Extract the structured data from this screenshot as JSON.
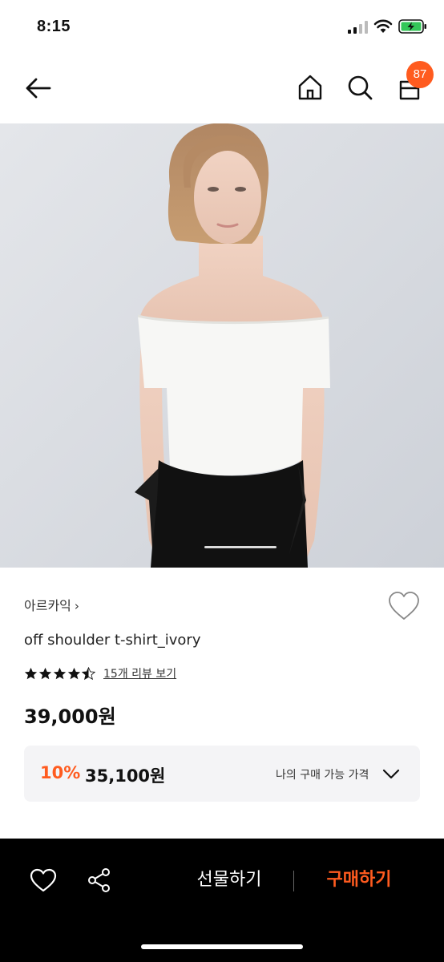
{
  "status_bar": {
    "time": "8:15"
  },
  "nav": {
    "cart_count": "87",
    "icons": [
      "back-arrow-icon",
      "home-icon",
      "search-icon",
      "cart-icon"
    ]
  },
  "product": {
    "brand": "아르카익",
    "brand_chevron": "›",
    "name": "off shoulder t-shirt_ivory",
    "rating": 4.5,
    "rating_max": 5,
    "review_link": "15개 리뷰 보기",
    "price": "39,000원",
    "discount": {
      "rate": "10%",
      "price": "35,100원",
      "label": "나의 구매 가능 가격"
    }
  },
  "bottom_bar": {
    "gift_label": "선물하기",
    "buy_label": "구매하기"
  },
  "colors": {
    "accent": "#ff5b1f",
    "bottom_bar_bg": "#000000",
    "discount_box_bg": "#f4f4f6"
  }
}
